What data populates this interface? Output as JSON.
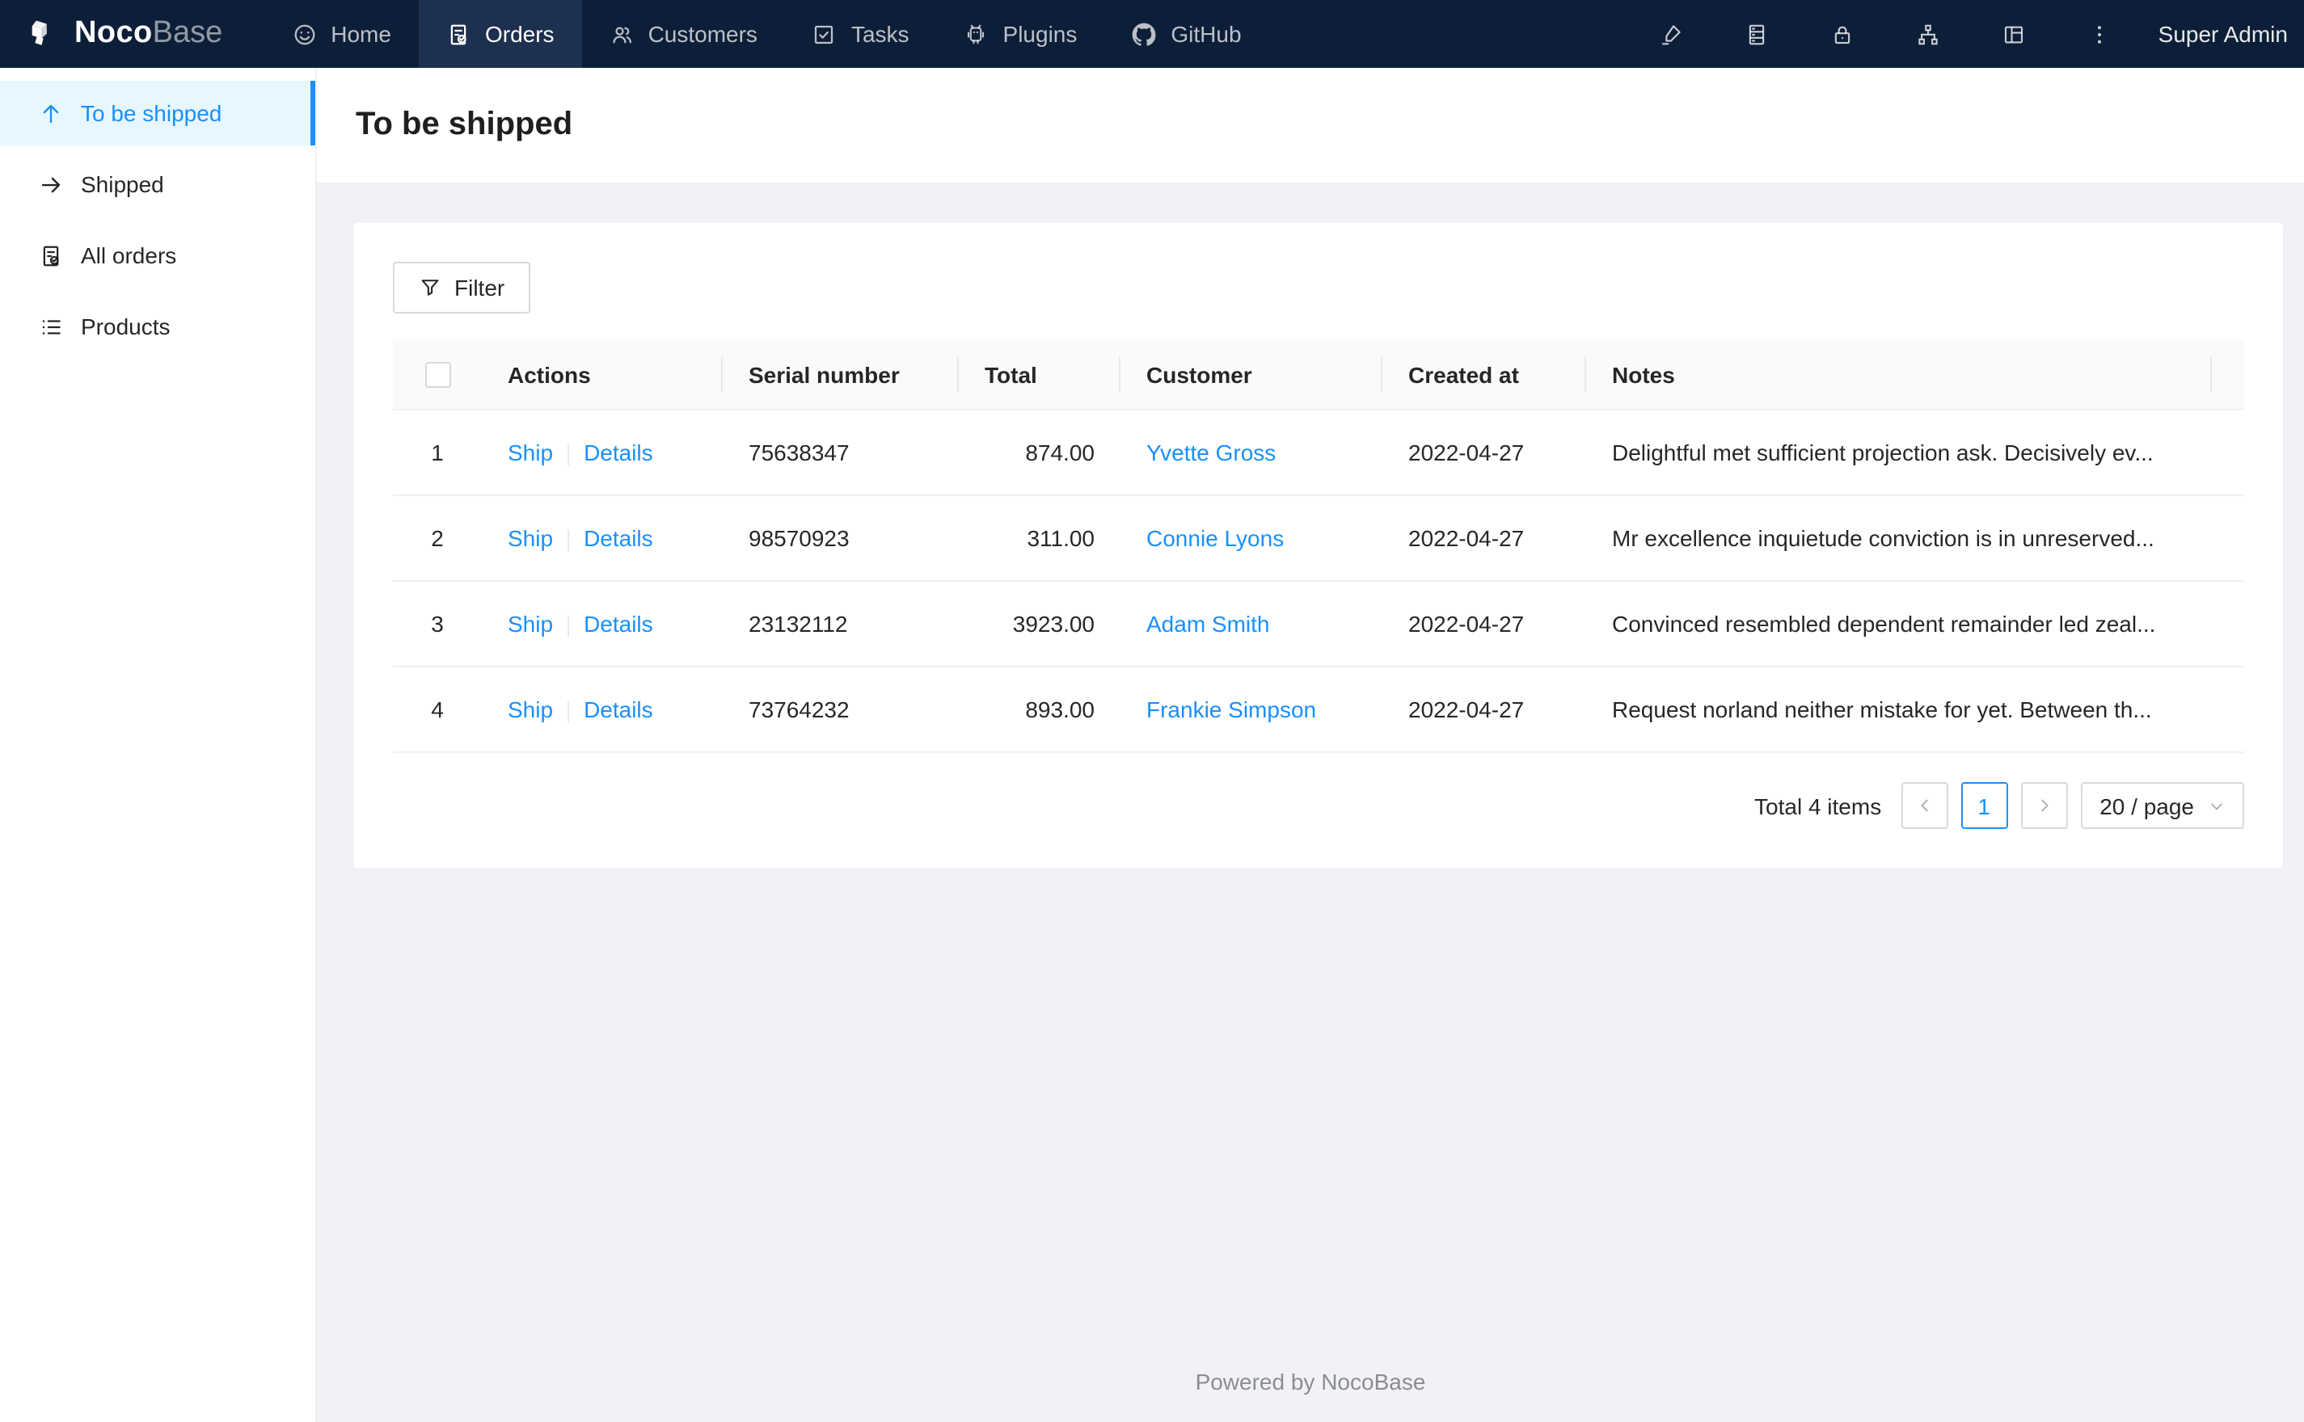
{
  "navbar": {
    "logo": {
      "noco": "Noco",
      "base": "Base"
    },
    "items": [
      {
        "label": "Home",
        "icon": "smile-icon",
        "active": false
      },
      {
        "label": "Orders",
        "icon": "file-done-icon",
        "active": true
      },
      {
        "label": "Customers",
        "icon": "team-icon",
        "active": false
      },
      {
        "label": "Tasks",
        "icon": "check-square-icon",
        "active": false
      },
      {
        "label": "Plugins",
        "icon": "robot-icon",
        "active": false
      },
      {
        "label": "GitHub",
        "icon": "github-icon",
        "active": false
      }
    ],
    "right_icons": [
      "highlighter-icon",
      "database-icon",
      "lock-icon",
      "sitemap-icon",
      "layout-icon",
      "more-icon"
    ],
    "user": "Super Admin"
  },
  "sidebar": {
    "items": [
      {
        "label": "To be shipped",
        "icon": "arrow-up-icon",
        "active": true
      },
      {
        "label": "Shipped",
        "icon": "arrow-right-icon",
        "active": false
      },
      {
        "label": "All orders",
        "icon": "file-done-icon",
        "active": false
      },
      {
        "label": "Products",
        "icon": "list-icon",
        "active": false
      }
    ]
  },
  "page": {
    "title": "To be shipped"
  },
  "toolbar": {
    "filter_label": "Filter"
  },
  "table": {
    "columns": {
      "actions": "Actions",
      "serial": "Serial number",
      "total": "Total",
      "customer": "Customer",
      "created_at": "Created at",
      "notes": "Notes"
    },
    "rows": [
      {
        "index": "1",
        "actions": [
          "Ship",
          "Details"
        ],
        "serial": "75638347",
        "total": "874.00",
        "customer": "Yvette Gross",
        "created_at": "2022-04-27",
        "notes": "Delightful met sufficient projection ask. Decisively ev..."
      },
      {
        "index": "2",
        "actions": [
          "Ship",
          "Details"
        ],
        "serial": "98570923",
        "total": "311.00",
        "customer": "Connie Lyons",
        "created_at": "2022-04-27",
        "notes": "Mr excellence inquietude conviction is in unreserved..."
      },
      {
        "index": "3",
        "actions": [
          "Ship",
          "Details"
        ],
        "serial": "23132112",
        "total": "3923.00",
        "customer": "Adam Smith",
        "created_at": "2022-04-27",
        "notes": "Convinced resembled dependent remainder led zeal..."
      },
      {
        "index": "4",
        "actions": [
          "Ship",
          "Details"
        ],
        "serial": "73764232",
        "total": "893.00",
        "customer": "Frankie Simpson",
        "created_at": "2022-04-27",
        "notes": "Request norland neither mistake for yet. Between th..."
      }
    ]
  },
  "pagination": {
    "total_text": "Total 4 items",
    "prev": "‹",
    "current_page": "1",
    "next": "›",
    "page_size": "20 / page"
  },
  "footer": {
    "text": "Powered by NocoBase"
  },
  "colors": {
    "accent": "#1890ff",
    "navbar_bg": "#0d1f38",
    "navbar_active_bg": "#1e3050",
    "sidebar_active_bg": "#e6f7ff",
    "page_bg": "#f0f2f5",
    "link": "#1890ff"
  }
}
